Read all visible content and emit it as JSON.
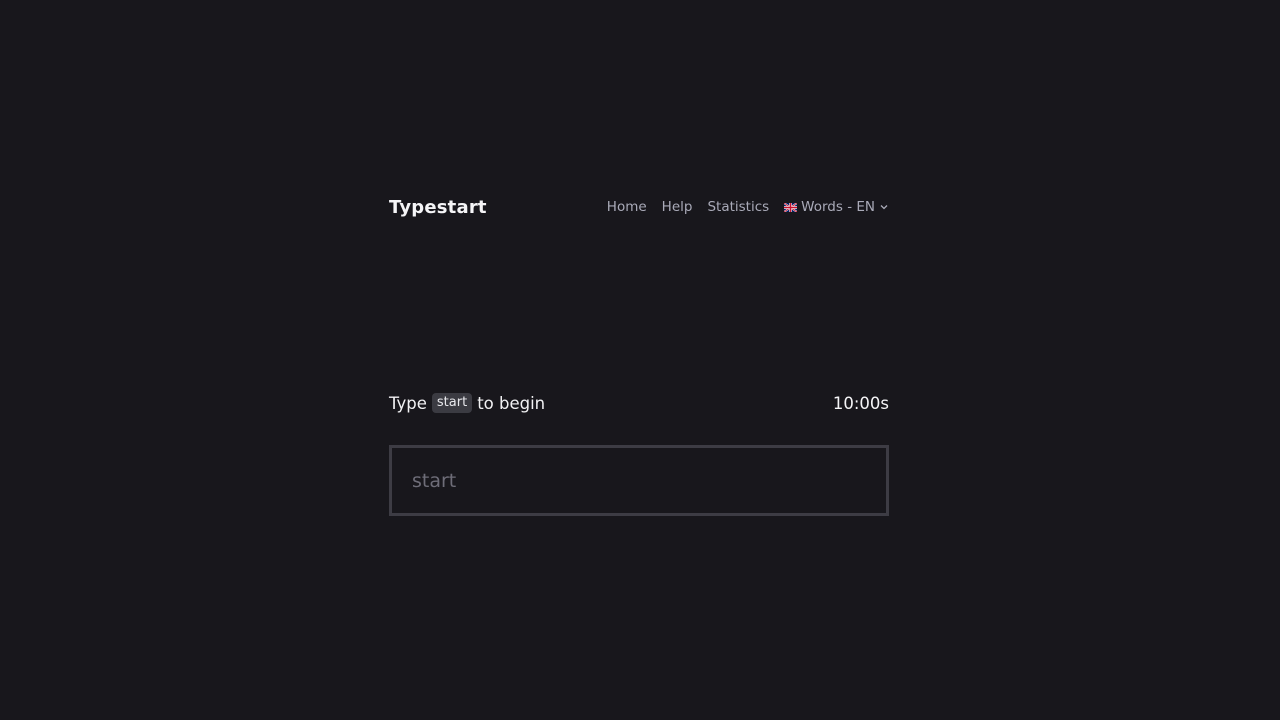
{
  "header": {
    "brand": "Typestart",
    "nav": {
      "home": "Home",
      "help": "Help",
      "statistics": "Statistics",
      "language_mode": "Words - EN"
    }
  },
  "prompt": {
    "prefix": "Type",
    "keyword": "start",
    "suffix": "to begin"
  },
  "timer": "10:00s",
  "typing_input": {
    "placeholder": "start",
    "value": ""
  },
  "icons": {
    "flag": "uk-flag-icon",
    "dropdown": "chevron-down-icon"
  },
  "colors": {
    "background": "#18171c",
    "text": "#f2f2f4",
    "muted": "#a9aab8",
    "border": "#3d3c44"
  }
}
